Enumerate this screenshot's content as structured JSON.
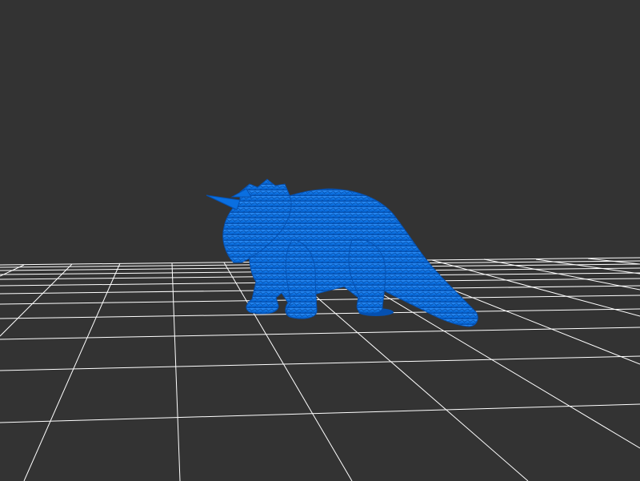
{
  "viewer": {
    "background_color": "#333333",
    "grid_color": "#ffffff",
    "model_color": "#0a6fe0",
    "model_shadow_color": "#0550b0",
    "model_highlight_color": "#2b8cf5"
  },
  "scene": {
    "model_name": "triceratops-model",
    "ground_grid": true
  }
}
